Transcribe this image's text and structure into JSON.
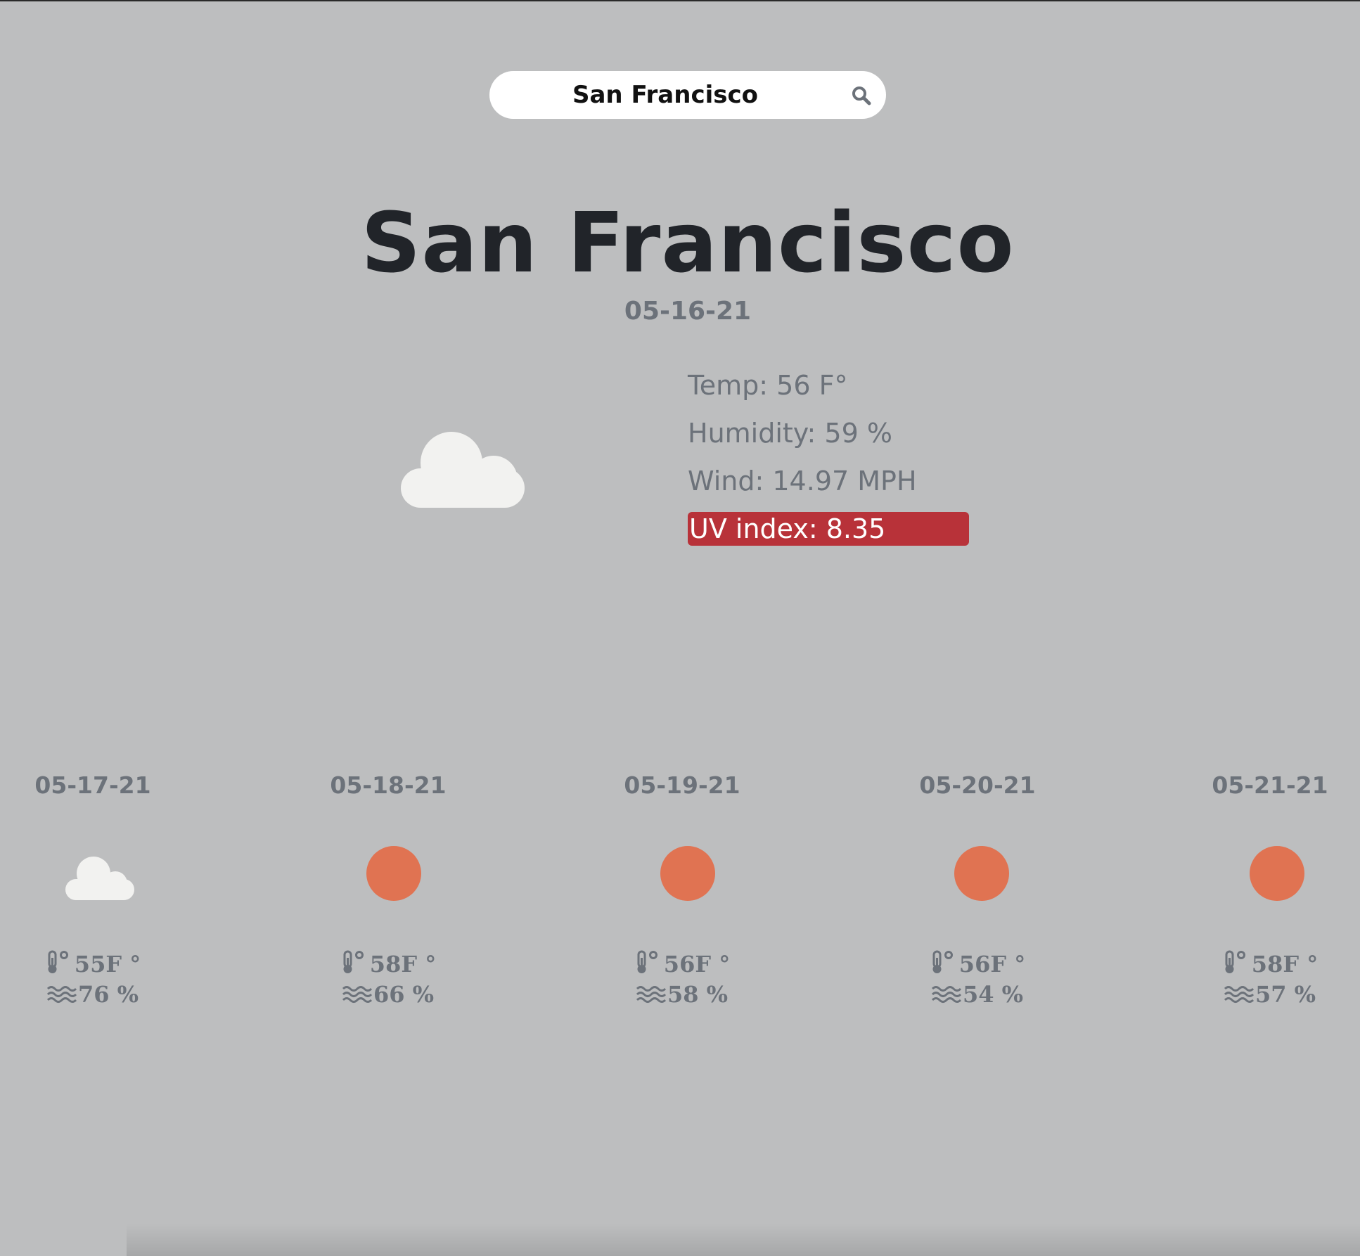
{
  "search": {
    "value": "San Francisco",
    "icon": "search-icon"
  },
  "current": {
    "city": "San Francisco",
    "date": "05-16-21",
    "icon": "cloud-icon",
    "temp_text": "Temp: 56 F°",
    "humidity_text": "Humidity: 59 %",
    "wind_text": "Wind: 14.97 MPH",
    "uv_text": "UV index: 8.35"
  },
  "forecast": [
    {
      "date": "05-17-21",
      "icon": "cloud-icon",
      "temp": "55F °",
      "humidity": "76 %"
    },
    {
      "date": "05-18-21",
      "icon": "sun-icon",
      "temp": "58F °",
      "humidity": "66 %"
    },
    {
      "date": "05-19-21",
      "icon": "sun-icon",
      "temp": "56F °",
      "humidity": "58 %"
    },
    {
      "date": "05-20-21",
      "icon": "sun-icon",
      "temp": "56F °",
      "humidity": "54 %"
    },
    {
      "date": "05-21-21",
      "icon": "sun-icon",
      "temp": "58F °",
      "humidity": "57 %"
    }
  ],
  "colors": {
    "background": "#bdbebf",
    "title": "#212429",
    "muted_text": "#6c727a",
    "uv_high": "#b83239",
    "sun": "#e07352",
    "cloud": "#f2f2f0"
  }
}
